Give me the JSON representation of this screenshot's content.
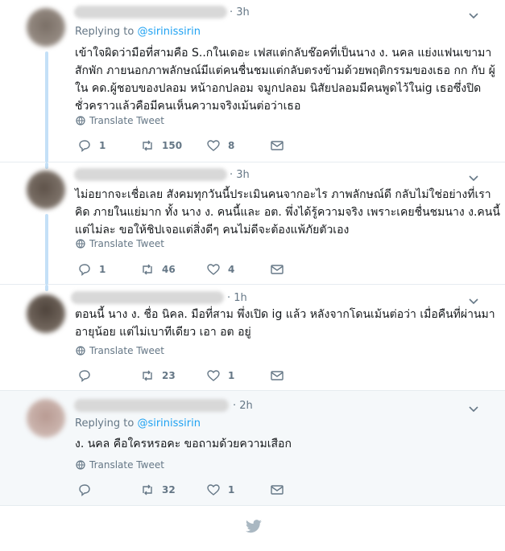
{
  "colors": {
    "accent": "#1da1f2",
    "muted": "#657786",
    "thread_line": "#c4e0f7",
    "focus_bg": "#f5f8fa",
    "bird": "#aab8c2"
  },
  "tweets": [
    {
      "time": "3h",
      "replying_prefix": "Replying to",
      "replying_handle": "@sirinissirin",
      "lines": [
        "เข้าใจผิดว่ามือที่สามคือ S..กในเดอะ เฟสแต่กลับช๊อคที่เป็นนาง ง. นคล แย่งแฟนเขามา",
        "สักพัก ภายนอกภาพลักษณ์มีแต่คนชื่นชมแต่กลับตรงข้ามด้วยพฤติกรรมของเธอ กก กับ ผู้",
        "ใน คด.ผู้ชอบของปลอม หน้าอกปลอม จมูกปลอม นิสัยปลอมมีคนพูดไว้ในig เธอซึ่งปิด",
        "ชั่วคราวแล้วคือมีคนเห็นความจริงเม้นต่อว่าเธอ"
      ],
      "translate": "Translate Tweet",
      "replies": "1",
      "retweets": "150",
      "likes": "8"
    },
    {
      "time": "3h",
      "lines": [
        "ไม่อยากจะเชื่อเลย สังคมทุกวันนี้ประเมินคนจากอะไร ภาพลักษณ์ดี กลับไม่ใช่อย่างที่เรา",
        "คิด ภายในแย่มาก ทั้ง นาง ง. คนนี้และ อต. พึ่งได้รู้ความจริง เพราะเคยชื่นชมนาง ง.คนนี้",
        "แต่ไม่ละ ขอให้ชิปเจอแต่สิ่งดีๆ คนไม่ดีจะต้องแพ้ภัยตัวเอง"
      ],
      "translate": "Translate Tweet",
      "replies": "1",
      "retweets": "46",
      "likes": "4"
    },
    {
      "time": "1h",
      "lines": [
        "ตอนนี้ นาง ง. ชื่อ นิคล. มือที่สาม พึ่งเปิด ig แล้ว หลังจากโดนเม้นต่อว่า เมื่อคืนที่ผ่านมา",
        "อายุน้อย แต่ไม่เบาทีเดียว เอา อต อยู่"
      ],
      "translate": "Translate Tweet",
      "replies": "",
      "retweets": "23",
      "likes": "1"
    },
    {
      "time": "2h",
      "replying_prefix": "Replying to",
      "replying_handle": "@sirinissirin",
      "lines": [
        "ง. นคล คือใครหรอคะ ขอถามด้วยความเสือก"
      ],
      "translate": "Translate Tweet",
      "replies": "",
      "retweets": "32",
      "likes": "1"
    }
  ]
}
